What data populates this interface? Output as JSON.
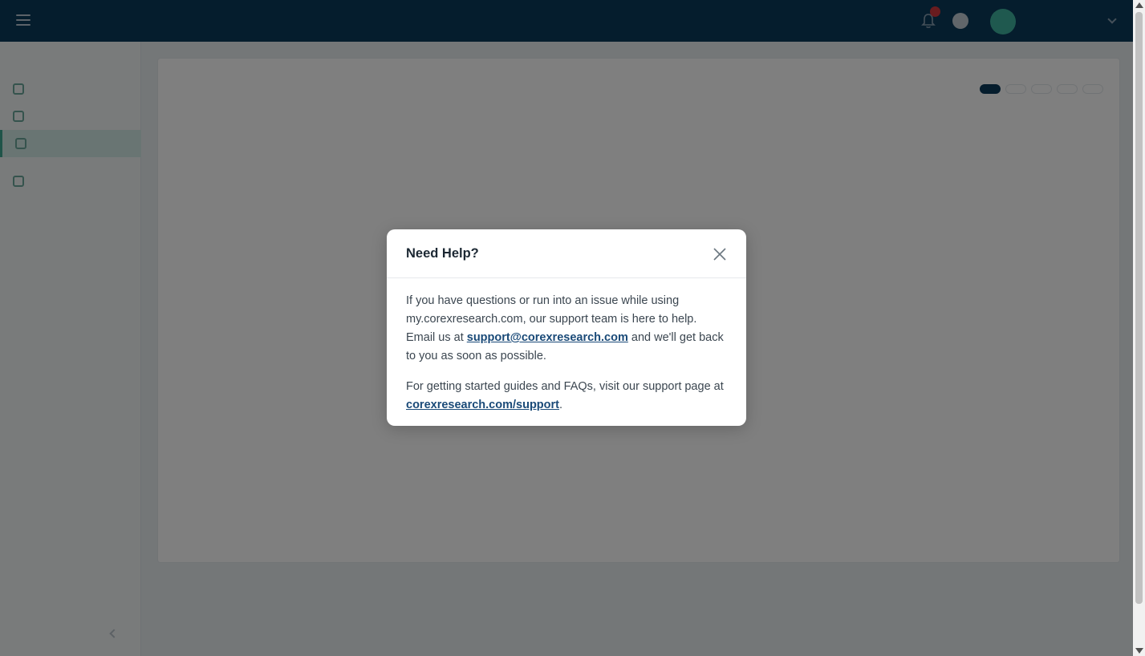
{
  "header": {
    "brand": "",
    "user_name": "",
    "user_role": ""
  },
  "sidebar": {
    "section": "",
    "items": [
      {
        "label": ""
      },
      {
        "label": ""
      },
      {
        "label": ""
      },
      {
        "label": ""
      }
    ]
  },
  "main": {
    "title": "",
    "subtitle": "",
    "filter_label": "",
    "chips": [
      "",
      "",
      "",
      "",
      ""
    ],
    "empty_list": "",
    "empty_title": "",
    "empty_sub": ""
  },
  "modal": {
    "title": "Need Help?",
    "p1_before": "If you have questions or run into an issue while using my.corexresearch.com, our support team is here to help. Email us at ",
    "email_link": "support@corexresearch.com",
    "p1_after": " and we'll get back to you as soon as possible.",
    "p2_before": "For getting started guides and FAQs, visit our support page at ",
    "support_link": "corexresearch.com/support",
    "p2_after": "."
  }
}
